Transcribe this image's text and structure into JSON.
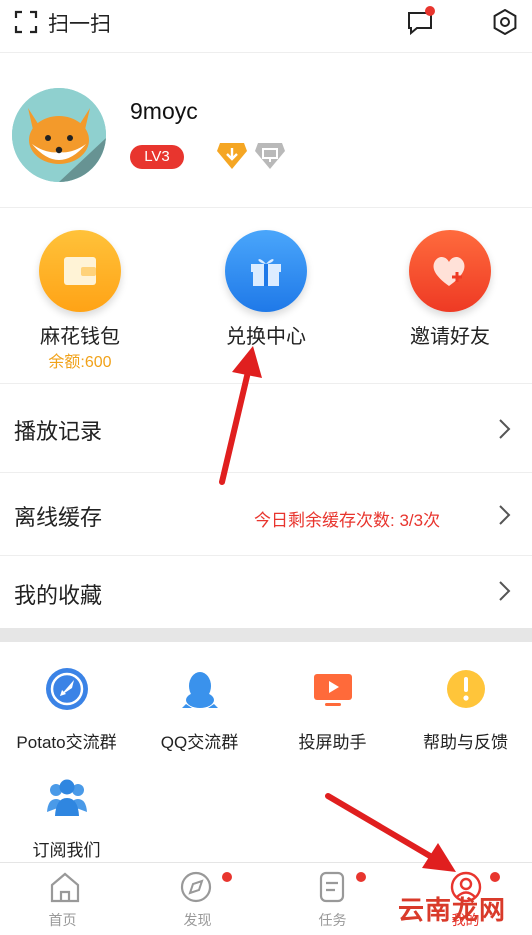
{
  "topbar": {
    "scan_label": "扫一扫"
  },
  "profile": {
    "username": "9moyc",
    "level": "LV3"
  },
  "quick_actions": [
    {
      "label": "麻花钱包",
      "sub": "余额:600",
      "color": "#ffb21d"
    },
    {
      "label": "兑换中心",
      "color": "#2c8bf0"
    },
    {
      "label": "邀请好友",
      "color": "#f5472b"
    }
  ],
  "rows": {
    "history": {
      "label": "播放记录"
    },
    "offline": {
      "label": "离线缓存",
      "note": "今日剩余缓存次数: 3/3次"
    },
    "favorites": {
      "label": "我的收藏"
    }
  },
  "community": [
    {
      "label": "Potato交流群",
      "icon": "rocket-icon"
    },
    {
      "label": "QQ交流群",
      "icon": "qq-penguin-icon"
    },
    {
      "label": "投屏助手",
      "icon": "cast-screen-icon"
    },
    {
      "label": "帮助与反馈",
      "icon": "help-feedback-icon"
    },
    {
      "label": "订阅我们",
      "icon": "subscribe-people-icon"
    }
  ],
  "bottom_nav": [
    {
      "label": "首页",
      "icon": "home-icon"
    },
    {
      "label": "发现",
      "icon": "compass-icon"
    },
    {
      "label": "任务",
      "icon": "task-icon"
    },
    {
      "label": "我的",
      "icon": "profile-icon",
      "active": true
    }
  ],
  "watermark": "云南龙网",
  "colors": {
    "accent": "#e8352e",
    "balance": "#f1a21a"
  }
}
